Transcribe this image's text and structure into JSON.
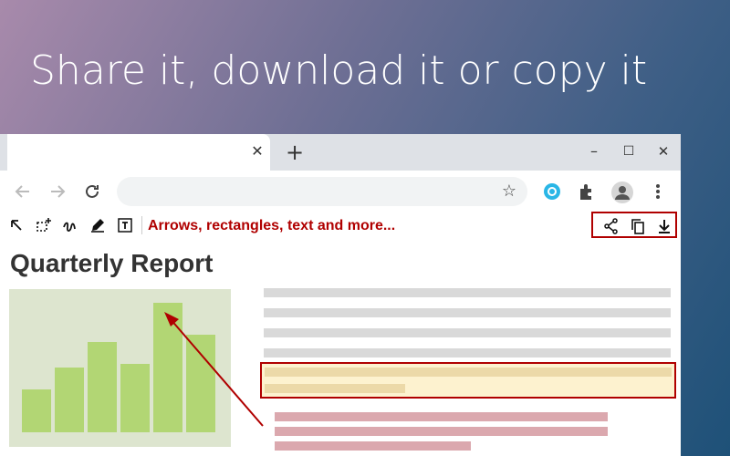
{
  "headline": "Share it, download it or copy it",
  "browser": {
    "tab_close": "✕",
    "new_tab": "+",
    "minimize": "–",
    "maximize": "☐",
    "close": "✕",
    "star": "☆"
  },
  "annotation_toolbar": {
    "hint": "Arrows, rectangles, text and more..."
  },
  "page": {
    "title": "Quarterly Report"
  },
  "chart_data": {
    "type": "bar",
    "values": [
      47,
      71,
      99,
      75,
      142,
      107
    ]
  },
  "colors": {
    "accent": "#b00000",
    "bar": "#b2d674",
    "chart_bg": "#dde5cf",
    "highlight_bg": "#fdf2cf",
    "pink_bar": "#dba8ae"
  }
}
